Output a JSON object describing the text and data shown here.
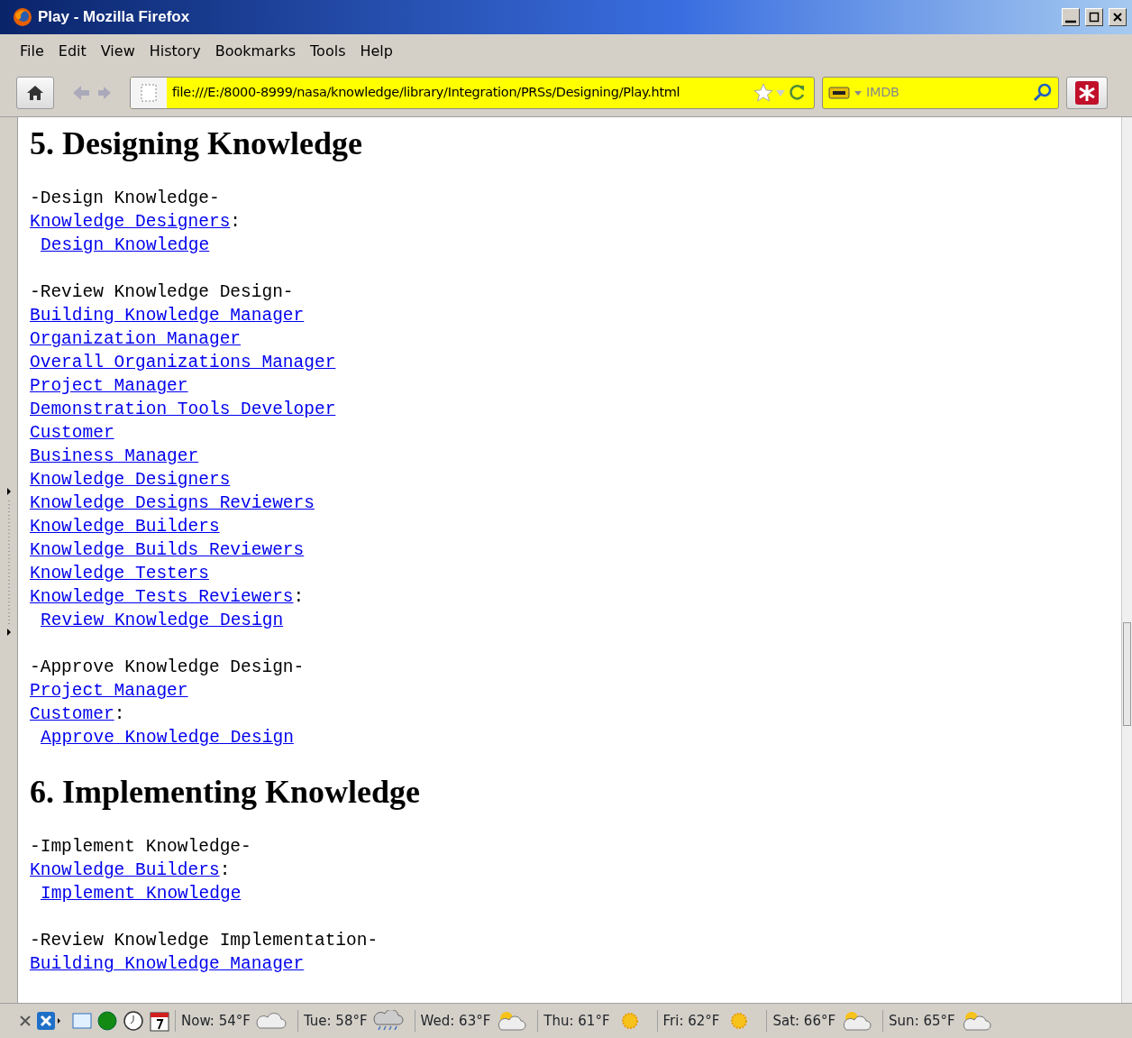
{
  "window": {
    "title": "Play - Mozilla Firefox"
  },
  "menu": [
    "File",
    "Edit",
    "View",
    "History",
    "Bookmarks",
    "Tools",
    "Help"
  ],
  "address": {
    "value": "file:///E:/8000-8999/nasa/knowledge/library/Integration/PRSs/Designing/Play.html"
  },
  "search": {
    "placeholder": "IMDB"
  },
  "sections": [
    {
      "heading": "5. Designing Knowledge",
      "blocks": [
        {
          "title": "-Design Knowledge-",
          "roles": [
            {
              "label": "Knowledge Designers",
              "suffix": ":"
            }
          ],
          "action": "Design Knowledge"
        },
        {
          "title": "-Review Knowledge Design-",
          "roles": [
            {
              "label": "Building Knowledge Manager"
            },
            {
              "label": "Organization Manager"
            },
            {
              "label": "Overall Organizations Manager"
            },
            {
              "label": "Project Manager"
            },
            {
              "label": "Demonstration Tools Developer"
            },
            {
              "label": "Customer"
            },
            {
              "label": "Business Manager"
            },
            {
              "label": "Knowledge Designers"
            },
            {
              "label": "Knowledge Designs Reviewers"
            },
            {
              "label": "Knowledge Builders"
            },
            {
              "label": "Knowledge Builds Reviewers"
            },
            {
              "label": "Knowledge Testers"
            },
            {
              "label": "Knowledge Tests Reviewers",
              "suffix": ":"
            }
          ],
          "action": "Review Knowledge Design"
        },
        {
          "title": "-Approve Knowledge Design-",
          "roles": [
            {
              "label": "Project Manager"
            },
            {
              "label": "Customer",
              "suffix": ":"
            }
          ],
          "action": "Approve Knowledge Design"
        }
      ]
    },
    {
      "heading": "6. Implementing Knowledge",
      "blocks": [
        {
          "title": "-Implement Knowledge-",
          "roles": [
            {
              "label": "Knowledge Builders",
              "suffix": ":"
            }
          ],
          "action": "Implement Knowledge"
        },
        {
          "title": "-Review Knowledge Implementation-",
          "roles": [
            {
              "label": "Building Knowledge Manager"
            }
          ]
        }
      ]
    }
  ],
  "status_bar": {
    "weather": [
      {
        "label": "Now: 54°F",
        "kind": "cloud"
      },
      {
        "label": "Tue: 58°F",
        "kind": "rain"
      },
      {
        "label": "Wed: 63°F",
        "kind": "partly"
      },
      {
        "label": "Thu: 61°F",
        "kind": "sun"
      },
      {
        "label": "Fri: 62°F",
        "kind": "sun"
      },
      {
        "label": "Sat: 66°F",
        "kind": "partly"
      },
      {
        "label": "Sun: 65°F",
        "kind": "partly"
      }
    ]
  }
}
